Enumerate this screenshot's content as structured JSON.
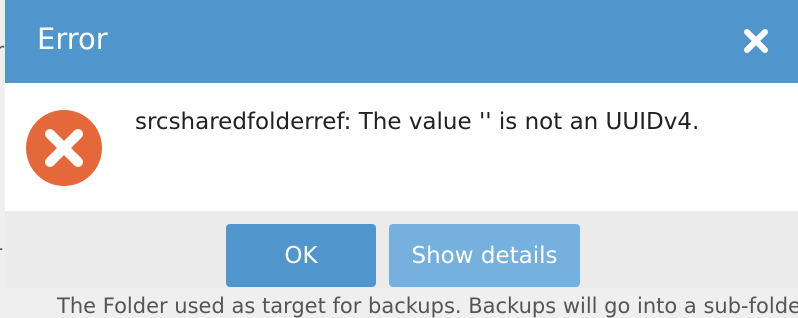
{
  "background": {
    "line1": "r",
    "line2": "-",
    "help_text": "The Folder used as target for backups. Backups will go into a sub-folder /"
  },
  "dialog": {
    "title": "Error",
    "message": "srcsharedfolderref: The value '' is not an UUIDv4.",
    "buttons": {
      "ok": "OK",
      "details": "Show details"
    },
    "icons": {
      "close": "close-icon",
      "error": "error-icon"
    }
  },
  "colors": {
    "header": "#5096cd",
    "button_primary": "#5096cd",
    "button_secondary": "#75b0de",
    "error": "#e4683a"
  }
}
